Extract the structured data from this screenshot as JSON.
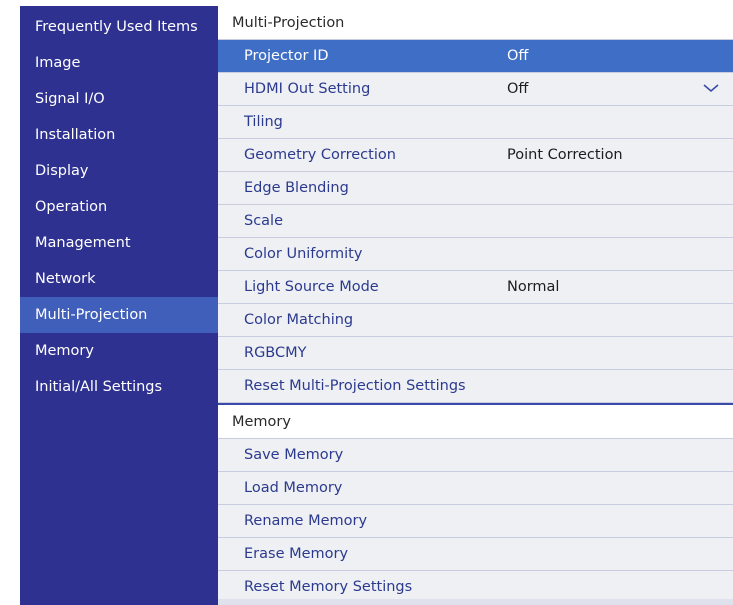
{
  "sidebar": {
    "items": [
      {
        "label": "Frequently Used Items"
      },
      {
        "label": "Image"
      },
      {
        "label": "Signal I/O"
      },
      {
        "label": "Installation"
      },
      {
        "label": "Display"
      },
      {
        "label": "Operation"
      },
      {
        "label": "Management"
      },
      {
        "label": "Network"
      },
      {
        "label": "Multi-Projection"
      },
      {
        "label": "Memory"
      },
      {
        "label": "Initial/All Settings"
      }
    ],
    "active_index": 8
  },
  "multi_projection": {
    "header": "Multi-Projection",
    "rows": [
      {
        "label": "Projector ID",
        "value": "Off"
      },
      {
        "label": "HDMI Out Setting",
        "value": "Off"
      },
      {
        "label": "Tiling",
        "value": ""
      },
      {
        "label": "Geometry Correction",
        "value": "Point Correction"
      },
      {
        "label": "Edge Blending",
        "value": ""
      },
      {
        "label": "Scale",
        "value": ""
      },
      {
        "label": "Color Uniformity",
        "value": ""
      },
      {
        "label": "Light Source Mode",
        "value": "Normal"
      },
      {
        "label": "Color Matching",
        "value": ""
      },
      {
        "label": "RGBCMY",
        "value": ""
      },
      {
        "label": "Reset Multi-Projection Settings",
        "value": ""
      }
    ],
    "selected_index": 0
  },
  "memory": {
    "header": "Memory",
    "rows": [
      {
        "label": "Save Memory"
      },
      {
        "label": "Load Memory"
      },
      {
        "label": "Rename Memory"
      },
      {
        "label": "Erase Memory"
      },
      {
        "label": "Reset Memory Settings"
      }
    ]
  },
  "icons": {
    "dropdown": "chevron-down-icon"
  },
  "colors": {
    "sidebar_bg": "#2e3190",
    "sidebar_active": "#3f5fba",
    "row_selected": "#3f6ec6",
    "row_text": "#2c3a8e",
    "content_bg": "#eef0f4"
  }
}
